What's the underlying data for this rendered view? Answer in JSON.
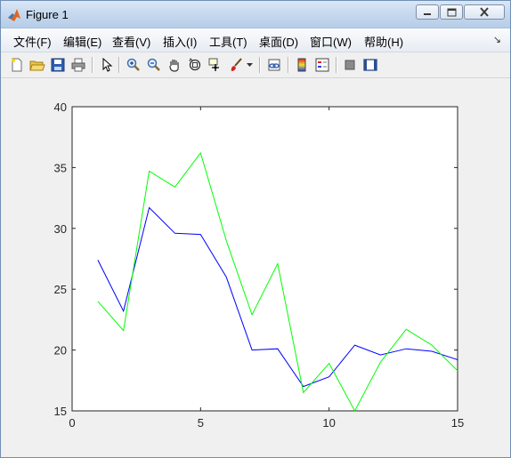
{
  "window": {
    "title": "Figure 1",
    "controls": {
      "minimize": "minimize",
      "maximize": "maximize",
      "close": "close"
    }
  },
  "menu": {
    "items": [
      {
        "label": "文件(F)",
        "key": "F"
      },
      {
        "label": "编辑(E)",
        "key": "E"
      },
      {
        "label": "查看(V)",
        "key": "V"
      },
      {
        "label": "插入(I)",
        "key": "I"
      },
      {
        "label": "工具(T)",
        "key": "T"
      },
      {
        "label": "桌面(D)",
        "key": "D"
      },
      {
        "label": "窗口(W)",
        "key": "W"
      },
      {
        "label": "帮助(H)",
        "key": "H"
      }
    ]
  },
  "toolbar": {
    "icons": [
      "new-figure-icon",
      "open-file-icon",
      "save-icon",
      "print-icon",
      "select-arrow-icon",
      "zoom-in-icon",
      "zoom-out-icon",
      "pan-hand-icon",
      "rotate-3d-icon",
      "data-cursor-icon",
      "brush-icon",
      "brush-dropdown-icon",
      "link-plot-icon",
      "colorbar-icon",
      "legend-icon",
      "hide-plot-tools-icon",
      "show-plot-tools-icon"
    ]
  },
  "colors": {
    "series_blue": "#0000ff",
    "series_green": "#00ff00",
    "axes_bg": "#ffffff",
    "figure_bg": "#f0f0f0"
  },
  "chart_data": {
    "type": "line",
    "xlim": [
      0,
      15
    ],
    "ylim": [
      15,
      40
    ],
    "xticks": [
      0,
      5,
      10,
      15
    ],
    "yticks": [
      15,
      20,
      25,
      30,
      35,
      40
    ],
    "grid": false,
    "series": [
      {
        "color": "#0000ff",
        "x": [
          1,
          2,
          3,
          4,
          5,
          6,
          7,
          8,
          9,
          10,
          11,
          12,
          13,
          14,
          15
        ],
        "y": [
          27.4,
          23.2,
          31.7,
          29.6,
          29.5,
          26.0,
          20.0,
          20.1,
          17.0,
          17.8,
          20.4,
          19.6,
          20.1,
          19.9,
          19.2
        ]
      },
      {
        "color": "#00ff00",
        "x": [
          1,
          2,
          3,
          4,
          5,
          6,
          7,
          8,
          9,
          10,
          11,
          12,
          13,
          14,
          15
        ],
        "y": [
          24.0,
          21.6,
          34.7,
          33.4,
          36.2,
          29.0,
          22.9,
          27.1,
          16.5,
          18.9,
          15.0,
          19.0,
          21.7,
          20.4,
          18.3
        ]
      }
    ]
  }
}
